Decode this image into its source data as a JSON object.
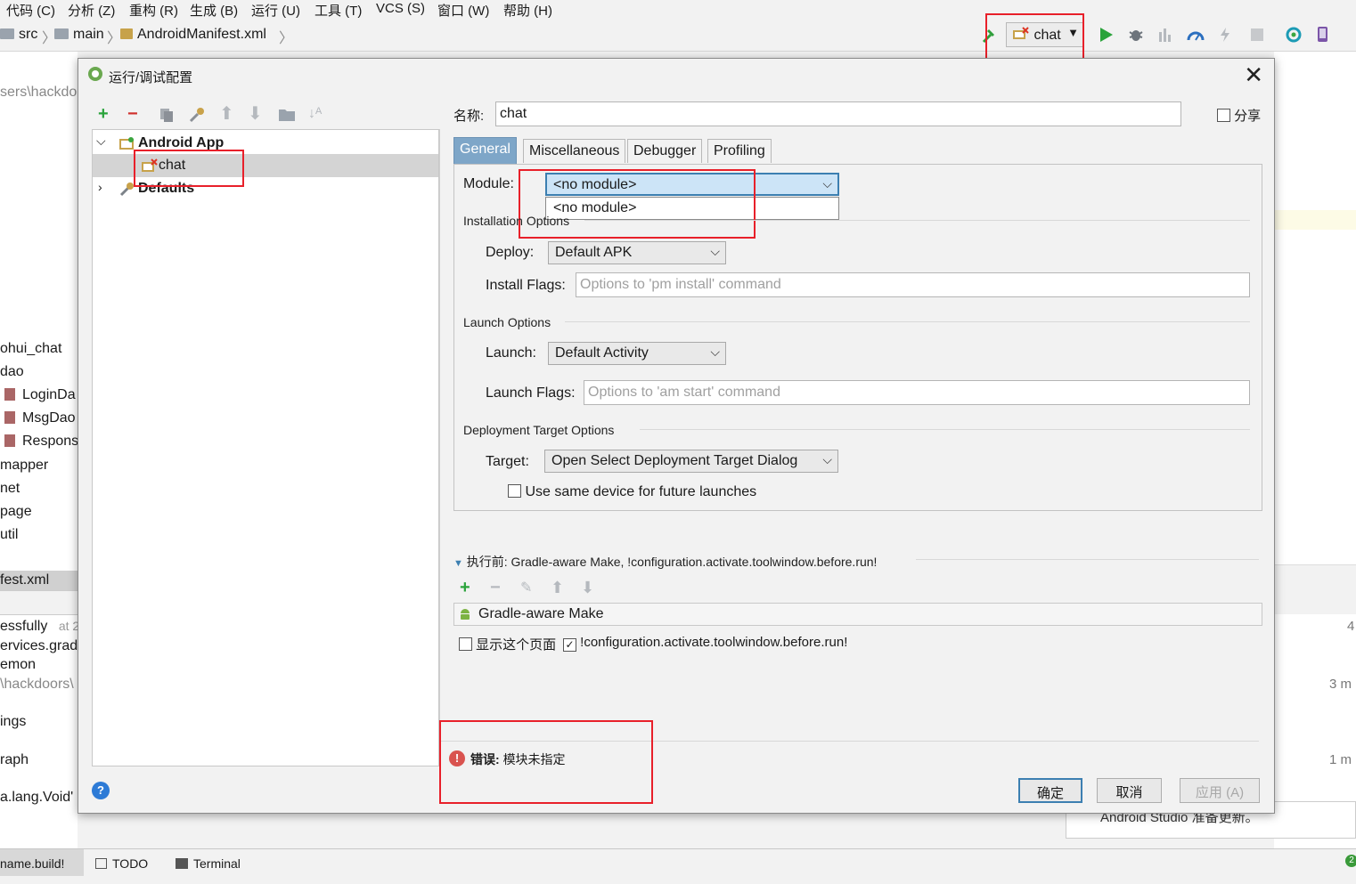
{
  "menu": {
    "items": [
      "代码 (C)",
      "分析 (Z)",
      "重构 (R)",
      "生成 (B)",
      "运行 (U)",
      "工具 (T)",
      "VCS (S)",
      "窗口 (W)",
      "帮助 (H)"
    ]
  },
  "navbar": {
    "crumbs": [
      "src",
      "main",
      "AndroidManifest.xml"
    ],
    "run_config": "chat"
  },
  "background": {
    "path_fragment": "sers\\hackdoo",
    "project_items": [
      "ohui_chat",
      "dao",
      "LoginDa",
      "MsgDao",
      "Respons",
      "mapper",
      "net",
      "page",
      "util"
    ],
    "selected_file": "fest.xml",
    "build_lines": [
      "essfully",
      "at 2",
      "ervices.grad",
      "emon",
      "\\hackdoors\\",
      "ings",
      "raph",
      "a.lang.Void'"
    ],
    "right_times": [
      "4",
      "3 m",
      "1 m"
    ],
    "notification": "Android Studio 准备更新。",
    "bottom_tabs": [
      "name.build!",
      "TODO",
      "Terminal"
    ],
    "bottom_badge": "2"
  },
  "dialog": {
    "title": "运行/调试配置",
    "tree": {
      "group": "Android App",
      "config": "chat",
      "defaults": "Defaults"
    },
    "name_label": "名称:",
    "name_value": "chat",
    "share_label": "分享",
    "tabs": [
      "General",
      "Miscellaneous",
      "Debugger",
      "Profiling"
    ],
    "module_label": "Module:",
    "module_value": "<no module>",
    "module_option": "<no module>",
    "installation_section": "Installation Options",
    "deploy_label": "Deploy:",
    "deploy_value": "Default APK",
    "install_flags_label": "Install Flags:",
    "install_flags_placeholder": "Options to 'pm install' command",
    "launch_section": "Launch Options",
    "launch_label": "Launch:",
    "launch_value": "Default Activity",
    "launch_flags_label": "Launch Flags:",
    "launch_flags_placeholder": "Options to 'am start' command",
    "target_section": "Deployment Target Options",
    "target_label": "Target:",
    "target_value": "Open Select Deployment Target Dialog",
    "same_device_label": "Use same device for future launches",
    "before_launch": "执行前: Gradle-aware Make, !configuration.activate.toolwindow.before.run!",
    "before_item": "Gradle-aware Make",
    "show_page_label": "显示这个页面",
    "activate_label": "!configuration.activate.toolwindow.before.run!",
    "error_prefix": "错误:",
    "error_message": "模块未指定",
    "ok": "确定",
    "cancel": "取消",
    "apply": "应用 (A)"
  },
  "colors": {
    "highlight": "#e8202a",
    "run_green": "#2aa33b",
    "selection": "#d4d4d4",
    "combo_selected": "#cce4f7"
  }
}
